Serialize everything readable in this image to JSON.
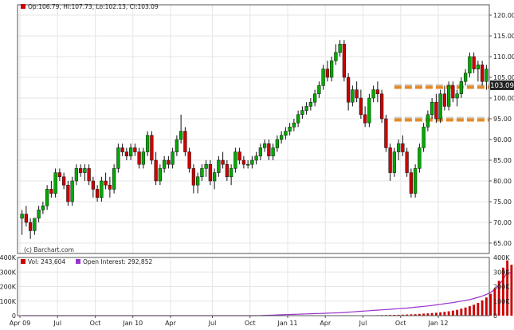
{
  "header": {
    "ohlc": "Op:106.79, Hi:107.73, Lo:102.13, Cl:103.09"
  },
  "watermark": "(c) Barchart.com",
  "volume_panel": {
    "vol_label": "Vol: 243,604",
    "oi_label": "Open Interest: 292,852"
  },
  "colors": {
    "up": "#00aa00",
    "down": "#cc0000",
    "grid": "#e6e6e6",
    "frame": "#555555",
    "support_band": "#e38a2a",
    "open_interest": "#9933cc",
    "last_price_bg": "#222222"
  },
  "chart_data": [
    {
      "type": "candlestick",
      "title": "",
      "ylabel": "",
      "ylim": [
        62.5,
        122.5
      ],
      "y_ticks": [
        65,
        70,
        75,
        80,
        85,
        90,
        95,
        100,
        105,
        110,
        115,
        120
      ],
      "y_tick_labels": [
        "65.00",
        "70.00",
        "75.00",
        "80.00",
        "85.00",
        "90.00",
        "95.00",
        "100.00",
        "105.00",
        "110.00",
        "115.00",
        "120.00"
      ],
      "x_tick_labels": [
        "Apr 09",
        "Jul",
        "Oct",
        "Jan 10",
        "Apr",
        "Jul",
        "Oct",
        "Jan 11",
        "Apr",
        "Jul",
        "Oct",
        "Jan 12"
      ],
      "last_price": "103.09",
      "support_resistance": [
        102.6,
        94.7
      ],
      "grid": true,
      "candles": [
        [
          71,
          73,
          67,
          72
        ],
        [
          72,
          74,
          69,
          70
        ],
        [
          70,
          71,
          66,
          68
        ],
        [
          68,
          71,
          67,
          71
        ],
        [
          71,
          74,
          70,
          73
        ],
        [
          73,
          75,
          72,
          74
        ],
        [
          74,
          79,
          73,
          78
        ],
        [
          78,
          80,
          76,
          77
        ],
        [
          77,
          83,
          76,
          82
        ],
        [
          82,
          83,
          80,
          81
        ],
        [
          81,
          82,
          78,
          79
        ],
        [
          79,
          80,
          74,
          75
        ],
        [
          75,
          81,
          74,
          80
        ],
        [
          80,
          84,
          79,
          83
        ],
        [
          83,
          84,
          81,
          82
        ],
        [
          82,
          84,
          80,
          83
        ],
        [
          83,
          84,
          79,
          80
        ],
        [
          80,
          81,
          76,
          78
        ],
        [
          78,
          79,
          75,
          76
        ],
        [
          76,
          81,
          75,
          80
        ],
        [
          80,
          82,
          78,
          79
        ],
        [
          79,
          81,
          76,
          78
        ],
        [
          78,
          84,
          77,
          83
        ],
        [
          83,
          89,
          82,
          88
        ],
        [
          88,
          89,
          86,
          87
        ],
        [
          87,
          88,
          85,
          86
        ],
        [
          86,
          89,
          85,
          88
        ],
        [
          88,
          89,
          86,
          87
        ],
        [
          87,
          88,
          83,
          84
        ],
        [
          84,
          88,
          83,
          87
        ],
        [
          87,
          92,
          86,
          91
        ],
        [
          91,
          92,
          84,
          85
        ],
        [
          85,
          87,
          79,
          80
        ],
        [
          80,
          84,
          79,
          83
        ],
        [
          83,
          86,
          82,
          85
        ],
        [
          85,
          86,
          83,
          84
        ],
        [
          84,
          88,
          83,
          87
        ],
        [
          87,
          91,
          86,
          90
        ],
        [
          90,
          96,
          89,
          92
        ],
        [
          92,
          93,
          86,
          87
        ],
        [
          87,
          88,
          82,
          83
        ],
        [
          83,
          84,
          77,
          79
        ],
        [
          79,
          82,
          77,
          81
        ],
        [
          81,
          84,
          80,
          83
        ],
        [
          83,
          85,
          81,
          84
        ],
        [
          84,
          85,
          79,
          80
        ],
        [
          80,
          83,
          78,
          82
        ],
        [
          82,
          86,
          81,
          85
        ],
        [
          85,
          87,
          83,
          84
        ],
        [
          84,
          85,
          80,
          81
        ],
        [
          81,
          84,
          79,
          83
        ],
        [
          83,
          88,
          82,
          87
        ],
        [
          87,
          88,
          84,
          85
        ],
        [
          85,
          86,
          83,
          84
        ],
        [
          84,
          85,
          83,
          84
        ],
        [
          84,
          86,
          83,
          85
        ],
        [
          85,
          87,
          84,
          86
        ],
        [
          86,
          89,
          85,
          88
        ],
        [
          88,
          90,
          87,
          89
        ],
        [
          89,
          90,
          85,
          86
        ],
        [
          86,
          89,
          85,
          88
        ],
        [
          88,
          91,
          87,
          90
        ],
        [
          90,
          92,
          89,
          91
        ],
        [
          91,
          93,
          90,
          92
        ],
        [
          92,
          94,
          91,
          93
        ],
        [
          93,
          95,
          92,
          94
        ],
        [
          94,
          97,
          93,
          96
        ],
        [
          96,
          98,
          95,
          97
        ],
        [
          97,
          99,
          96,
          98
        ],
        [
          98,
          100,
          97,
          99
        ],
        [
          99,
          102,
          98,
          101
        ],
        [
          101,
          104,
          100,
          103
        ],
        [
          103,
          108,
          102,
          107
        ],
        [
          107,
          109,
          104,
          105
        ],
        [
          105,
          110,
          104,
          109
        ],
        [
          109,
          113,
          108,
          111
        ],
        [
          111,
          114,
          110,
          113
        ],
        [
          113,
          114,
          104,
          105
        ],
        [
          105,
          106,
          97,
          99
        ],
        [
          99,
          103,
          98,
          102
        ],
        [
          102,
          104,
          99,
          100
        ],
        [
          100,
          102,
          95,
          96
        ],
        [
          96,
          98,
          93,
          94
        ],
        [
          94,
          101,
          93,
          100
        ],
        [
          100,
          103,
          99,
          102
        ],
        [
          102,
          104,
          99,
          101
        ],
        [
          101,
          102,
          94,
          95
        ],
        [
          95,
          96,
          87,
          88
        ],
        [
          88,
          89,
          80,
          82
        ],
        [
          82,
          88,
          81,
          87
        ],
        [
          87,
          90,
          85,
          89
        ],
        [
          89,
          91,
          86,
          87
        ],
        [
          87,
          88,
          81,
          82
        ],
        [
          82,
          83,
          76,
          77
        ],
        [
          77,
          84,
          76,
          83
        ],
        [
          83,
          89,
          82,
          88
        ],
        [
          88,
          94,
          87,
          93
        ],
        [
          93,
          97,
          92,
          96
        ],
        [
          96,
          100,
          95,
          99
        ],
        [
          99,
          101,
          94,
          95
        ],
        [
          95,
          102,
          94,
          101
        ],
        [
          101,
          103,
          97,
          98
        ],
        [
          98,
          104,
          97,
          103
        ],
        [
          103,
          104,
          99,
          100
        ],
        [
          100,
          102,
          98,
          101
        ],
        [
          101,
          105,
          100,
          104
        ],
        [
          104,
          107,
          103,
          106
        ],
        [
          106,
          111,
          105,
          110
        ],
        [
          110,
          111,
          106,
          107
        ],
        [
          107,
          109,
          104,
          108
        ],
        [
          108,
          109,
          103,
          104
        ],
        [
          104,
          108,
          102,
          107
        ]
      ]
    },
    {
      "type": "bar",
      "title": "",
      "ylabel": "",
      "ylim": [
        0,
        400000
      ],
      "y_ticks": [
        0,
        100000,
        200000,
        300000,
        400000
      ],
      "y_tick_labels": [
        "0",
        "100K",
        "200K",
        "300K",
        "400K"
      ],
      "series": [
        {
          "name": "Vol",
          "values": [
            0,
            0,
            0,
            0,
            0,
            0,
            0,
            0,
            0,
            0,
            0,
            0,
            0,
            0,
            0,
            0,
            0,
            0,
            0,
            0,
            0,
            0,
            0,
            0,
            0,
            0,
            0,
            0,
            0,
            0,
            0,
            0,
            0,
            0,
            0,
            0,
            0,
            0,
            0,
            0,
            0,
            0,
            0,
            0,
            0,
            0,
            0,
            0,
            0,
            0,
            0,
            0,
            0,
            0,
            0,
            0,
            0,
            0,
            0,
            0,
            0,
            0,
            0,
            0,
            0,
            0,
            0,
            0,
            0,
            0,
            0,
            0,
            0,
            0,
            0,
            0,
            0,
            0,
            1000,
            1200,
            1500,
            1800,
            2000,
            2500,
            3000,
            3500,
            4000,
            4500,
            5000,
            5500,
            6000,
            7000,
            8000,
            9000,
            10000,
            12000,
            14000,
            16000,
            18000,
            20000,
            23000,
            26000,
            30000,
            35000,
            40000,
            48000,
            56000,
            65000,
            75000,
            88000,
            105000,
            125000,
            150000,
            185000,
            240000,
            330000,
            380000,
            350000,
            243604
          ]
        },
        {
          "name": "Open Interest",
          "values": [
            0,
            0,
            0,
            0,
            0,
            0,
            0,
            0,
            0,
            0,
            0,
            0,
            0,
            0,
            0,
            0,
            0,
            0,
            0,
            0,
            0,
            0,
            0,
            0,
            0,
            0,
            0,
            0,
            0,
            0,
            0,
            0,
            0,
            0,
            0,
            0,
            0,
            0,
            0,
            0,
            0,
            0,
            0,
            0,
            0,
            0,
            0,
            0,
            0,
            0,
            0,
            0,
            0,
            0,
            0,
            0,
            0,
            1000,
            2000,
            3000,
            4000,
            5000,
            6000,
            7000,
            8000,
            9000,
            10000,
            11000,
            12000,
            13000,
            14000,
            15000,
            16000,
            17000,
            18000,
            19000,
            20000,
            22000,
            24000,
            26000,
            28000,
            30000,
            32000,
            34000,
            36000,
            38000,
            40000,
            42000,
            44000,
            46000,
            48000,
            50000,
            52000,
            55000,
            58000,
            61000,
            64000,
            67000,
            70000,
            74000,
            78000,
            82000,
            86000,
            90000,
            95000,
            100000,
            105000,
            110000,
            118000,
            126000,
            135000,
            145000,
            160000,
            180000,
            210000,
            250000,
            300000,
            292852
          ]
        }
      ]
    }
  ]
}
